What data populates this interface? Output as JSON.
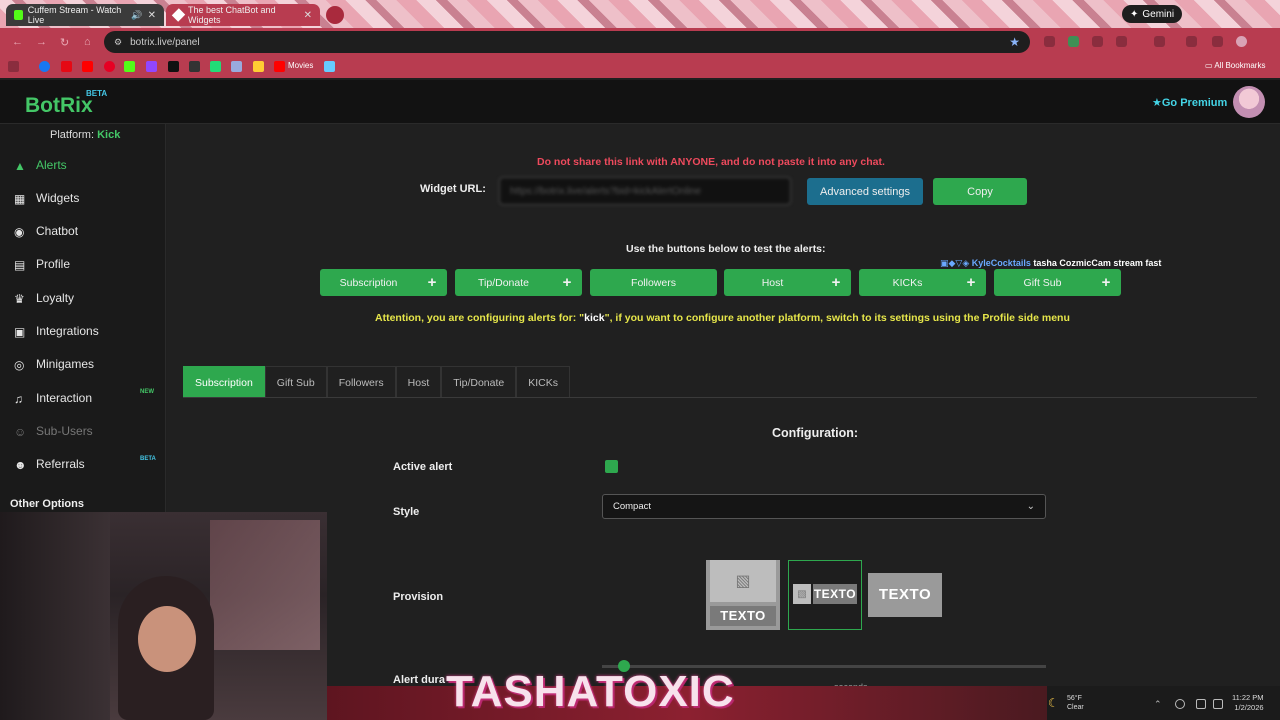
{
  "browser": {
    "tabs": [
      {
        "title": "Cuffem Stream - Watch Live"
      },
      {
        "title": "The best ChatBot and Widgets"
      }
    ],
    "gemini_label": "Gemini",
    "url": "botrix.live/panel",
    "bookmarks": {
      "movies": "Movies",
      "all": "All Bookmarks"
    }
  },
  "app": {
    "logo": "BotRix",
    "logo_badge": "BETA",
    "premium": "Go Premium",
    "platform_label": "Platform:",
    "platform_value": "Kick"
  },
  "sidebar": {
    "items": [
      {
        "label": "Alerts"
      },
      {
        "label": "Widgets"
      },
      {
        "label": "Chatbot"
      },
      {
        "label": "Profile"
      },
      {
        "label": "Loyalty"
      },
      {
        "label": "Integrations"
      },
      {
        "label": "Minigames"
      },
      {
        "label": "Interaction",
        "badge": "NEW"
      },
      {
        "label": "Sub-Users"
      },
      {
        "label": "Referrals",
        "badge": "BETA"
      }
    ],
    "other_options": "Other Options"
  },
  "main": {
    "warning": "Do not share this link with ANYONE, and do not paste it into any chat.",
    "widget_url_label": "Widget URL:",
    "widget_url_value": "https://botrix.live/alerts?bid=kickAlertOnline",
    "advanced_settings": "Advanced settings",
    "copy": "Copy",
    "test_label": "Use the buttons below to test the alerts:",
    "test_buttons": [
      {
        "label": "Subscription",
        "plus": "+"
      },
      {
        "label": "Tip/Donate",
        "plus": "+"
      },
      {
        "label": "Followers"
      },
      {
        "label": "Host",
        "plus": "+"
      },
      {
        "label": "KICKs",
        "plus": "+"
      },
      {
        "label": "Gift Sub",
        "plus": "+"
      }
    ],
    "attention_prefix": "Attention, you are configuring alerts for: \"",
    "attention_platform": "kick",
    "attention_suffix": "\", if you want to configure another platform, switch to its settings using the Profile side menu",
    "tabs": [
      {
        "label": "Subscription"
      },
      {
        "label": "Gift Sub"
      },
      {
        "label": "Followers"
      },
      {
        "label": "Host"
      },
      {
        "label": "Tip/Donate"
      },
      {
        "label": "KICKs"
      }
    ],
    "config_title": "Configuration:",
    "active_alert_label": "Active alert",
    "style_label": "Style",
    "style_value": "Compact",
    "provision_label": "Provision",
    "provision_text": "TEXTO",
    "alert_duration_label": "Alert dura",
    "seconds_label": "seconds"
  },
  "chat_overlay": {
    "user": "KyleCocktails",
    "message": "tasha CozmicCam stream fast"
  },
  "stream_overlay": {
    "brand": "TASHATOXIC"
  },
  "taskbar": {
    "temp": "56°F",
    "condition": "Clear",
    "time": "11:22 PM",
    "date": "1/2/2026"
  },
  "colors": {
    "accent": "#2ea84e",
    "info": "#1c6e8e",
    "warning": "#ee4a5d",
    "attention": "#e6e64a",
    "browser": "#b83c50"
  }
}
